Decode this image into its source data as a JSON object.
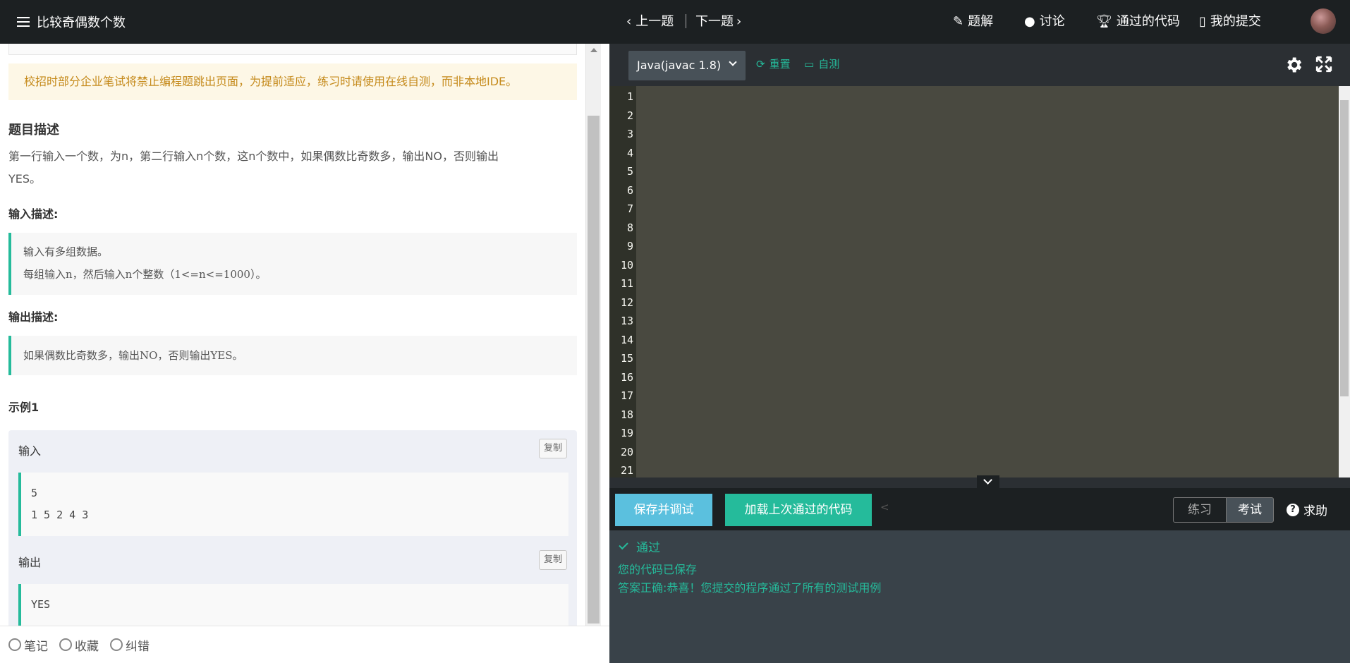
{
  "problem": {
    "title": "比较奇偶数个数",
    "notice": "校招时部分企业笔试将禁止编程题跳出页面，为提前适应，练习时请使用在线自测，而非本地IDE。",
    "desc_heading": "题目描述",
    "desc_line1": "第一行输入一个数，为n，第二行输入n个数，这n个数中，如果偶数比奇数多，输出NO，否则输出",
    "desc_line2": "YES。",
    "input_heading": "输入描述:",
    "input_line1": "输入有多组数据。",
    "input_line2": "每组输入n，然后输入n个整数（1<=n<=1000）。",
    "output_heading": "输出描述:",
    "output_line1": "如果偶数比奇数多，输出NO，否则输出YES。",
    "example_heading": "示例1",
    "example_input_label": "输入",
    "example_input_line1": "5",
    "example_input_line2": "1 5 2 4 3",
    "example_output_label": "输出",
    "example_output_line1": "YES",
    "copy_label": "复制"
  },
  "footer": {
    "note": "笔记",
    "favorite": "收藏",
    "report": "纠错"
  },
  "nav": {
    "prev": "上一题",
    "next": "下一题",
    "solution": "题解",
    "discuss": "讨论",
    "passed_code": "通过的代码",
    "my_submissions": "我的提交"
  },
  "toolbar": {
    "language": "Java(javac 1.8)",
    "reset": "重置",
    "self_test": "自测"
  },
  "editor": {
    "line_numbers": [
      "1",
      "2",
      "3",
      "4",
      "5",
      "6",
      "7",
      "8",
      "9",
      "10",
      "11",
      "12",
      "13",
      "14",
      "15",
      "16",
      "17",
      "18",
      "19",
      "20",
      "21"
    ]
  },
  "actions": {
    "save_debug": "保存并调试",
    "load_last": "加载上次通过的代码",
    "lt": "<",
    "practice": "练习",
    "exam": "考试",
    "help": "求助"
  },
  "result": {
    "status": "通过",
    "saved": "您的代码已保存",
    "correct": "答案正确:恭喜！您提交的程序通过了所有的测试用例"
  },
  "colors": {
    "accent": "#25bb9b",
    "info": "#5bc0de",
    "dark": "#1c2022"
  }
}
